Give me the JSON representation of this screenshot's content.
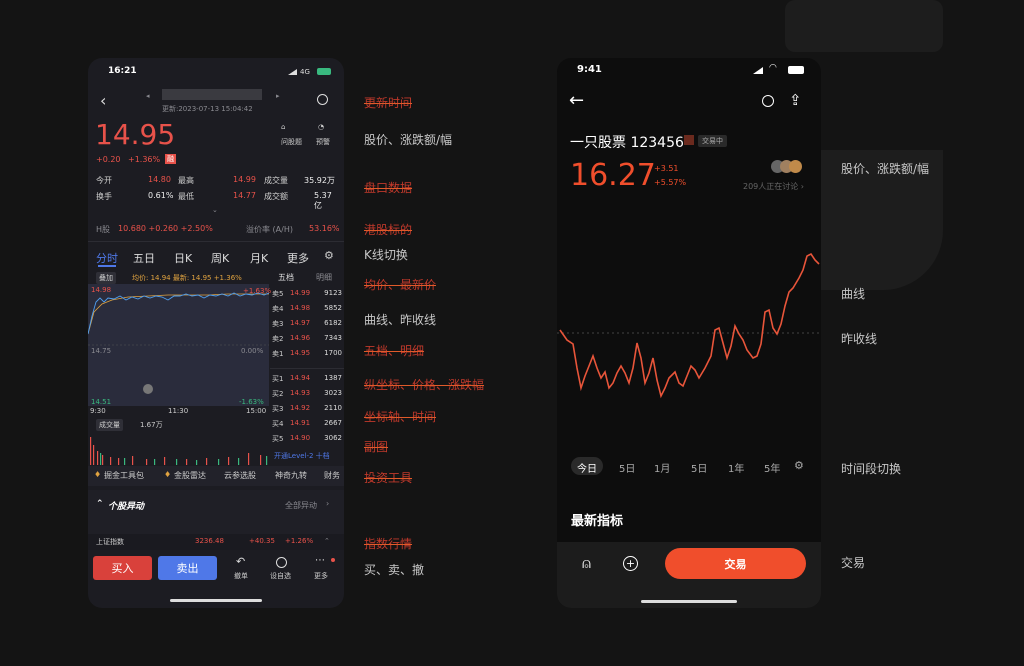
{
  "colors": {
    "up": "#e8524a",
    "down": "#39b97f",
    "accent": "#f04e2c",
    "blue": "#4f78e8"
  },
  "left_phone": {
    "status_time": "16:21",
    "network": "4G",
    "header": {
      "update_time": "更新:2023-07-13 15:04:42"
    },
    "price": "14.95",
    "change": "+0.20",
    "change_pct": "+1.36%",
    "badge": "融",
    "tools": [
      {
        "label": "问股题"
      },
      {
        "label": "预警"
      }
    ],
    "quote": [
      {
        "k": "今开",
        "v": "14.80",
        "k2": "最高",
        "v2": "14.99",
        "k3": "成交量",
        "v3": "35.92万"
      },
      {
        "k": "换手",
        "v": "0.61%",
        "k2": "最低",
        "v2": "14.77",
        "k3": "成交额",
        "v3": "5.37亿"
      }
    ],
    "hk": {
      "label": "H股",
      "value": "10.680 +0.260 +2.50%",
      "premium_label": "溢价率 (A/H)",
      "premium": "53.16%"
    },
    "ktabs": [
      "分时",
      "五日",
      "日K",
      "周K",
      "月K",
      "更多"
    ],
    "overlay_label": "叠加",
    "avg_info": "均价: 14.94 最新: 14.95 +1.36%",
    "book_tabs": [
      "五档",
      "明细"
    ],
    "axis": {
      "top": "14.98",
      "top_pct": "+1.63%",
      "mid": "14.75",
      "mid_pct": "0.00%",
      "bot": "14.51",
      "bot_pct": "-1.63%",
      "t1": "9:30",
      "t2": "11:30",
      "t3": "15:00"
    },
    "vol_label": "成交量",
    "vol_value": "1.67万",
    "asks": [
      [
        "卖5",
        "14.99",
        "9123"
      ],
      [
        "卖4",
        "14.98",
        "5852"
      ],
      [
        "卖3",
        "14.97",
        "6182"
      ],
      [
        "卖2",
        "14.96",
        "7343"
      ],
      [
        "卖1",
        "14.95",
        "1700"
      ]
    ],
    "bids": [
      [
        "买1",
        "14.94",
        "1387"
      ],
      [
        "买2",
        "14.93",
        "3023"
      ],
      [
        "买3",
        "14.92",
        "2110"
      ],
      [
        "买4",
        "14.91",
        "2667"
      ],
      [
        "买5",
        "14.90",
        "3062"
      ]
    ],
    "level2": "开通Level-2 十档",
    "toolbar": [
      "掘金工具包",
      "金股雷达",
      "云参选股",
      "神奇九转",
      "财务"
    ],
    "section": {
      "title": "个股异动",
      "more": "全部异动"
    },
    "index": {
      "name": "上证指数",
      "value": "3236.48",
      "change": "+40.35",
      "pct": "+1.26%"
    },
    "actions": {
      "buy": "买入",
      "sell": "卖出",
      "cancel": "撤单",
      "watch": "设自选",
      "more": "更多"
    }
  },
  "left_annotations": [
    {
      "text": "更新时间",
      "strike": true
    },
    {
      "text": "股价、涨跌额/幅",
      "strike": false
    },
    {
      "text": "盘口数据",
      "strike": true
    },
    {
      "text": "港股标的",
      "strike": true
    },
    {
      "text": "K线切换",
      "strike": false
    },
    {
      "text": "均价、最新价",
      "strike": true
    },
    {
      "text": "曲线、昨收线",
      "strike": false
    },
    {
      "text": "五档、明细",
      "strike": true
    },
    {
      "text": "纵坐标、价格、涨跌幅",
      "strike": true
    },
    {
      "text": "坐标轴、时间",
      "strike": true
    },
    {
      "text": "副图",
      "strike": true
    },
    {
      "text": "投资工具",
      "strike": true
    },
    {
      "text": "指数行情",
      "strike": true
    },
    {
      "text": "买、卖、撤",
      "strike": false
    }
  ],
  "right_phone": {
    "status_time": "9:41",
    "stock_name": "一只股票 123456",
    "tag": "交易中",
    "price": "16.27",
    "change": "+3.51",
    "change_pct": "+5.57%",
    "discussing": "209人正在讨论 ›",
    "periods": [
      "今日",
      "5日",
      "1月",
      "5日",
      "1年",
      "5年"
    ],
    "section_title": "最新指标",
    "trade": "交易"
  },
  "right_annotations": [
    "股价、涨跌额/幅",
    "曲线",
    "昨收线",
    "时间段切换",
    "交易"
  ]
}
